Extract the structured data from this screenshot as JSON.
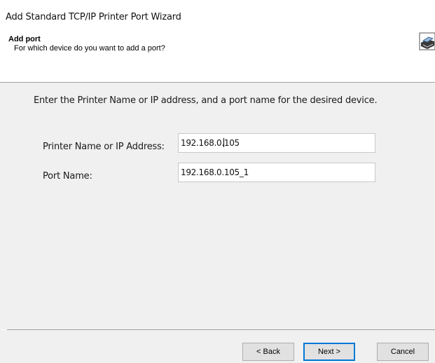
{
  "window": {
    "title": "Add Standard TCP/IP Printer Port Wizard"
  },
  "header": {
    "title": "Add port",
    "subtitle": "For which device do you want to add a port?",
    "icon": "printer-wizard-icon"
  },
  "content": {
    "instruction": "Enter the Printer Name or IP address, and a port name for the desired device.",
    "printer_label": "Printer Name or IP Address:",
    "printer_value_before_caret": "192.168.0.",
    "printer_value_after_caret": "105",
    "port_label": "Port Name:",
    "port_value": "192.168.0.105_1"
  },
  "buttons": {
    "back": "< Back",
    "next": "Next >",
    "cancel": "Cancel"
  },
  "colors": {
    "content_bg": "#f0f0f0",
    "default_button_border": "#0078d7"
  }
}
